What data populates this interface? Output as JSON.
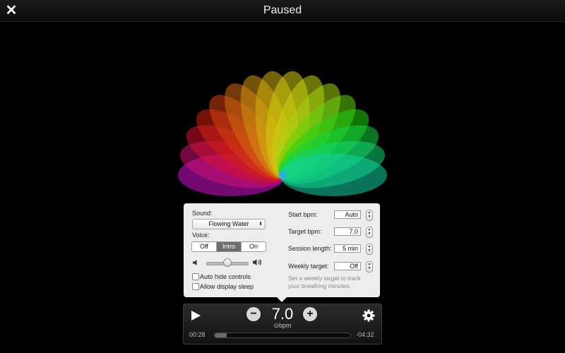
{
  "window": {
    "title": "Paused"
  },
  "settings": {
    "sound_label": "Sound:",
    "sound_value": "Flowing Water",
    "voice_label": "Voice:",
    "voice_options": [
      "Off",
      "Intro",
      "On"
    ],
    "voice_selected": "Intro",
    "volume_level": 0.45,
    "auto_hide_label": "Auto hide controls",
    "auto_hide_checked": false,
    "display_sleep_label": "Allow display sleep",
    "display_sleep_checked": false,
    "start_bpm_label": "Start bpm:",
    "start_bpm_value": "Auto",
    "target_bpm_label": "Target bpm:",
    "target_bpm_value": "7.0",
    "session_length_label": "Session length:",
    "session_length_value": "5 min",
    "weekly_target_label": "Weekly target:",
    "weekly_target_value": "Off",
    "weekly_help": "Set a weekly target to track your breathing minutes."
  },
  "player": {
    "bpm_value": "7.0",
    "bpm_unit": "⊙bpm",
    "elapsed": "00:28",
    "remaining": "-04:32",
    "progress_fraction": 0.09
  },
  "icons": {
    "close": "close-icon",
    "play": "play-icon",
    "minus": "minus-icon",
    "plus": "plus-icon",
    "settings": "gear-icon",
    "volume_low": "volume-low-icon",
    "volume_high": "volume-high-icon"
  },
  "colors": {
    "background": "#000000",
    "popover": "#ededed",
    "segment_selected": "#6d6d6d"
  }
}
